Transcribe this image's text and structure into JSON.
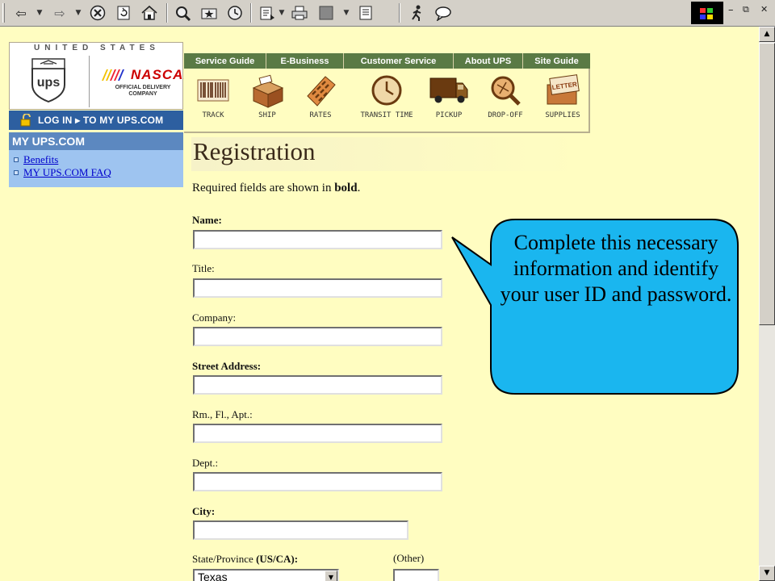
{
  "toolbar": {
    "back_icon": "back-arrow-icon",
    "forward_icon": "forward-arrow-icon",
    "icons": [
      "stop-icon",
      "refresh-icon",
      "home-icon",
      "search-icon",
      "favorites-icon",
      "history-icon",
      "mail-icon",
      "print-icon",
      "edit-icon",
      "discuss-icon",
      "messenger-icon"
    ]
  },
  "window": {
    "minimize": "–",
    "restore": "⧉",
    "close": "✕"
  },
  "logo": {
    "united_states": "UNITED STATES",
    "ups": "ups",
    "nascar": "NASCAR",
    "nascar_sub": "OFFICIAL DELIVERY COMPANY"
  },
  "login": {
    "label": "LOG IN ▸ TO MY UPS.COM"
  },
  "myups": {
    "header": "MY UPS.COM",
    "links": [
      "Benefits",
      "MY UPS.COM FAQ"
    ]
  },
  "nav": {
    "tabs": [
      "Service Guide",
      "E-Business",
      "Customer Service",
      "About UPS",
      "Site Guide"
    ],
    "icons": [
      "TRACK",
      "SHIP",
      "RATES",
      "TRANSIT TIME",
      "PICKUP",
      "DROP-OFF",
      "SUPPLIES"
    ]
  },
  "form": {
    "title": "Registration",
    "required_note_prefix": "Required fields are shown in ",
    "required_note_bold": "bold",
    "required_note_suffix": ".",
    "fields": [
      {
        "label": "Name:",
        "bold": true
      },
      {
        "label": "Title:",
        "bold": false
      },
      {
        "label": "Company:",
        "bold": false
      },
      {
        "label": "Street Address:",
        "bold": true
      },
      {
        "label": "Rm., Fl., Apt.:",
        "bold": false
      },
      {
        "label": "Dept.:",
        "bold": false
      },
      {
        "label": "City:",
        "bold": true
      }
    ],
    "state_label_prefix": "State/Province ",
    "state_label_bold": "(US/CA):",
    "state_value": "Texas",
    "other_label": "(Other)"
  },
  "callout": {
    "text": "Complete this necessary information and identify your user ID and password.",
    "fill": "#1ab6ef",
    "stroke": "#000000"
  },
  "colors": {
    "page_bg": "#fffdc1",
    "nav_green": "#5a7a45",
    "login_blue": "#2d5fa0",
    "link_blue": "#0000cc"
  }
}
